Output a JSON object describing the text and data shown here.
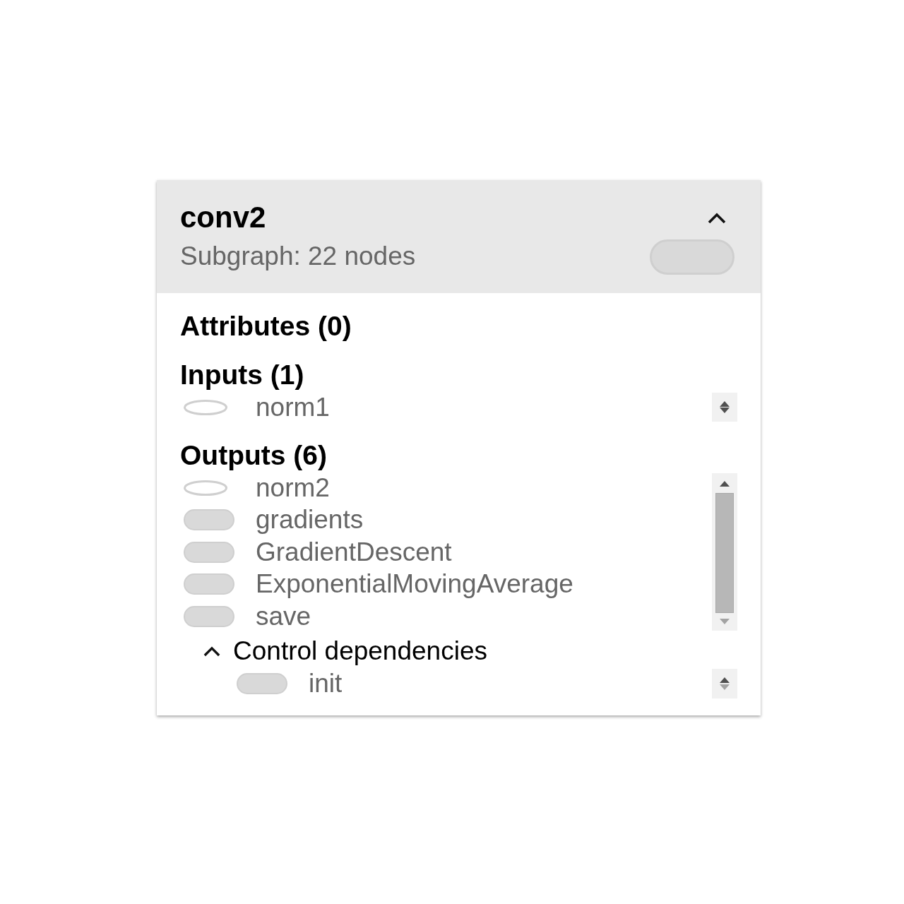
{
  "card": {
    "title": "conv2",
    "subtitle": "Subgraph: 22 nodes",
    "kind": "meta",
    "expanded": true
  },
  "attributes": {
    "title": "Attributes (0)"
  },
  "inputs": {
    "title": "Inputs (1)",
    "items": [
      {
        "name": "norm1",
        "kind": "op"
      }
    ]
  },
  "outputs": {
    "title": "Outputs (6)",
    "items": [
      {
        "name": "norm2",
        "kind": "op"
      },
      {
        "name": "gradients",
        "kind": "meta"
      },
      {
        "name": "GradientDescent",
        "kind": "meta"
      },
      {
        "name": "ExponentialMovingAverage",
        "kind": "meta"
      },
      {
        "name": "save",
        "kind": "meta"
      }
    ]
  },
  "control_dependencies": {
    "title": "Control dependencies",
    "expanded": true,
    "items": [
      {
        "name": "init",
        "kind": "meta"
      }
    ]
  }
}
